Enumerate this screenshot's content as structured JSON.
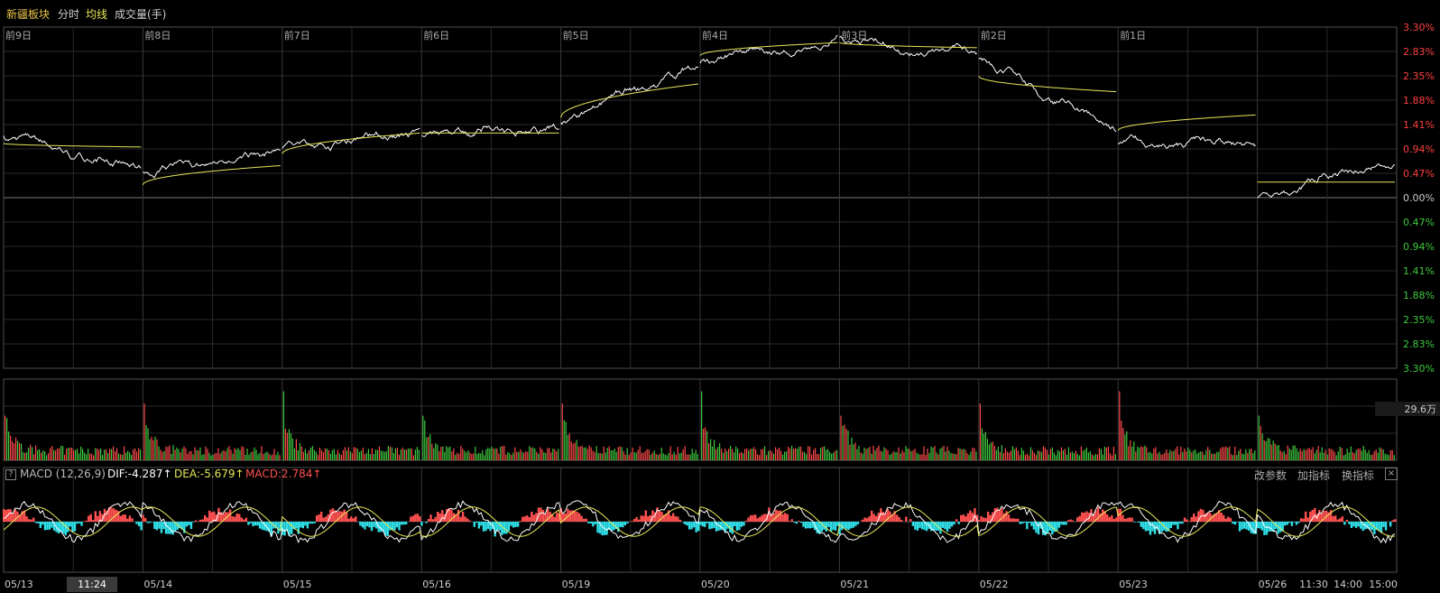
{
  "top_bar": {
    "title": "新疆板块",
    "tab_fenshi": "分时",
    "tab_junxian": "均线",
    "tab_volume": "成交量(手)"
  },
  "price_axis": {
    "labels_up": [
      "3.30%",
      "2.83%",
      "2.35%",
      "1.88%",
      "1.41%",
      "0.94%",
      "0.47%"
    ],
    "label_zero": "0.00%",
    "labels_down": [
      "0.47%",
      "0.94%",
      "1.41%",
      "1.88%",
      "2.35%",
      "2.83%",
      "3.30%"
    ],
    "up_color": "#ff4040",
    "down_color": "#3ec83e",
    "zero_color": "#c8c8c8"
  },
  "day_labels": [
    "前9日",
    "前8日",
    "前7日",
    "前6日",
    "前5日",
    "前4日",
    "前3日",
    "前2日",
    "前1日"
  ],
  "volume_axis": {
    "max_label": "29.6万"
  },
  "macd": {
    "name": "MACD (12,26,9)",
    "dif": "DIF:-4.287↑",
    "dea": "DEA:-5.679↑",
    "macd": "MACD:2.784↑",
    "buttons": [
      "改参数",
      "加指标",
      "换指标"
    ],
    "close_glyph": "×",
    "help_glyph": "?"
  },
  "x_axis": {
    "dates": [
      "05/13",
      "05/14",
      "05/15",
      "05/16",
      "05/19",
      "05/20",
      "05/21",
      "05/22",
      "05/23",
      "05/26"
    ],
    "cursor_time": "11:24",
    "end_times": [
      "11:30",
      "14:00",
      "15:00"
    ]
  },
  "chart_data": {
    "type": "line",
    "x": [
      "05/13",
      "05/14",
      "05/15",
      "05/16",
      "05/19",
      "05/20",
      "05/21",
      "05/22",
      "05/23",
      "05/26"
    ],
    "series": [
      {
        "values_pct_open_close": [
          [
            1.2,
            0.55
          ],
          [
            0.5,
            0.9
          ],
          [
            0.95,
            1.25
          ],
          [
            1.2,
            1.3
          ],
          [
            1.45,
            2.6
          ],
          [
            2.6,
            3.1
          ],
          [
            3.1,
            2.8
          ],
          [
            2.7,
            1.3
          ],
          [
            1.05,
            1.0
          ],
          [
            0.0,
            0.75
          ]
        ],
        "color": "#ffffff"
      },
      {
        "values_pct_avg_start_end": [
          [
            1.05,
            0.98
          ],
          [
            0.25,
            0.62
          ],
          [
            0.85,
            1.25
          ],
          [
            1.25,
            1.25
          ],
          [
            1.55,
            2.2
          ],
          [
            2.75,
            3.0
          ],
          [
            3.0,
            2.9
          ],
          [
            2.35,
            2.05
          ],
          [
            1.3,
            1.6
          ],
          [
            0.3,
            0.3
          ]
        ],
        "color": "#e8e85a"
      }
    ],
    "volume_max": "29.6万",
    "volume_up_color": "#ff4a4a",
    "volume_down_color": "#3ec83e",
    "macd_pos_color": "#ff5050",
    "macd_neg_color": "#30e0e8",
    "ylim_pct": [
      -3.3,
      3.3
    ]
  }
}
